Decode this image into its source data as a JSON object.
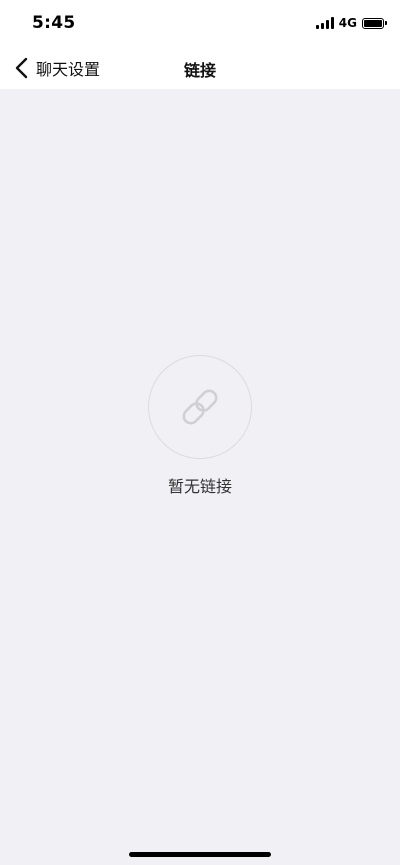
{
  "status_bar": {
    "time": "5:45",
    "network": "4G",
    "signal_bars": 4,
    "battery_level": 1.0
  },
  "nav": {
    "back_label": "聊天设置",
    "back_icon": "chevron-left-icon",
    "title": "链接"
  },
  "empty_state": {
    "icon": "link-icon",
    "message": "暂无链接"
  },
  "colors": {
    "background": "#f1f1f5",
    "bar_background": "#ffffff",
    "icon_stroke": "#cfcfd4",
    "text_primary": "#111111"
  }
}
